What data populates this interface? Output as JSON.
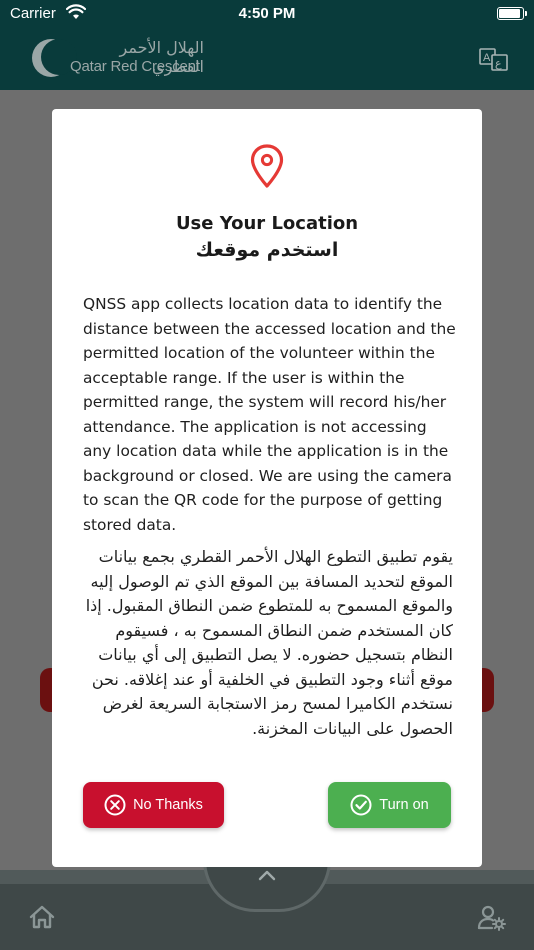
{
  "status_bar": {
    "carrier": "Carrier",
    "time": "4:50 PM",
    "battery_level": 0.95
  },
  "header": {
    "logo_arabic": "الهلال الأحمر القطري",
    "logo_english": "Qatar Red Crescent",
    "language_icon": "translate-icon"
  },
  "modal": {
    "icon": "location-pin-icon",
    "title_en": "Use Your Location",
    "title_ar": "استخدم موقعك",
    "body_en": "QNSS app collects location data to identify the distance between the accessed location and the permitted location of the volunteer within the acceptable range. If the user is within the permitted range, the system will record his/her attendance. The application is not accessing any location data while the application is in the background or closed. We are using the camera to scan the QR code for the purpose of getting stored data.",
    "body_ar": "يقوم تطبيق التطوع الهلال الأحمر القطري بجمع بيانات الموقع لتحديد المسافة بين الموقع الذي تم الوصول إليه والموقع المسموح به للمتطوع ضمن النطاق المقبول. إذا كان المستخدم ضمن النطاق المسموح به ، فسيقوم النظام بتسجيل حضوره. لا يصل التطبيق إلى أي بيانات موقع أثناء وجود التطبيق في الخلفية أو عند إغلاقه. نحن نستخدم الكاميرا لمسح رمز الاستجابة السريعة لغرض الحصول على البيانات المخزنة.",
    "no_thanks_label": "No Thanks",
    "turn_on_label": "Turn on"
  },
  "tab_bar": {
    "home_icon": "home-icon",
    "profile_icon": "user-settings-icon",
    "center_icon": "chevron-up-icon"
  },
  "colors": {
    "header_bg": "#093b3b",
    "no_thanks": "#c8102e",
    "turn_on": "#4caf50",
    "pin": "#e53935"
  }
}
